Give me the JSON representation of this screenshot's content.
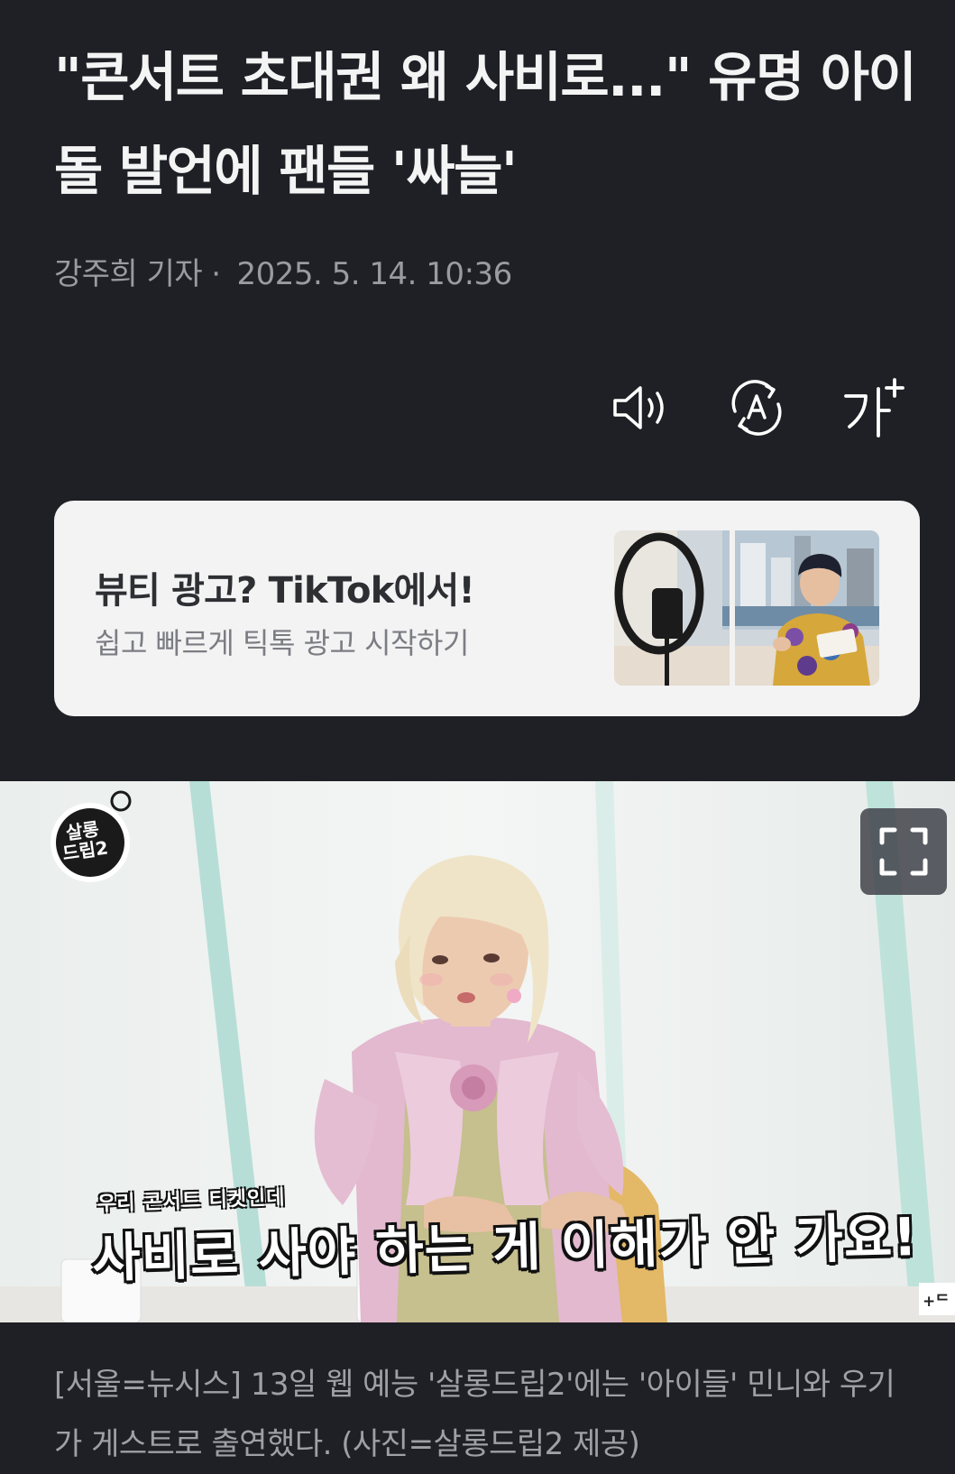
{
  "article": {
    "headline": "\"콘서트 초대권 왜 사비로...\" 유명 아이돌 발언에 팬들 '싸늘'",
    "reporter": "강주희 기자",
    "separator": "·",
    "timestamp": "2025. 5. 14. 10:36"
  },
  "toolbar": {
    "tts_icon": "speaker-icon",
    "translate_icon": "translate-icon",
    "font_size_icon": "font-size-icon",
    "font_size_glyph": "가"
  },
  "ad": {
    "title": "뷰티 광고? TikTok에서!",
    "subtitle": "쉽고 빠르게 틱톡 광고 시작하기"
  },
  "photo": {
    "logo_text": "살롱드립2",
    "subtitle_small": "우리 콘서트 티켓인데",
    "subtitle_big": "사비로 사야 하는 게 이해가 안 가요!",
    "corner_mark": "+ᄃ",
    "fullscreen_icon": "fullscreen-icon",
    "caption": "[서울=뉴시스] 13일 웹 예능 '살롱드립2'에는 '아이들' 민니와 우기가 게스트로 출연했다. (사진=살롱드립2 제공)"
  },
  "colors": {
    "background": "#1f2025",
    "headline": "#f4f4f5",
    "meta": "#9a9ba1",
    "ad_background": "#f3f3f4"
  }
}
